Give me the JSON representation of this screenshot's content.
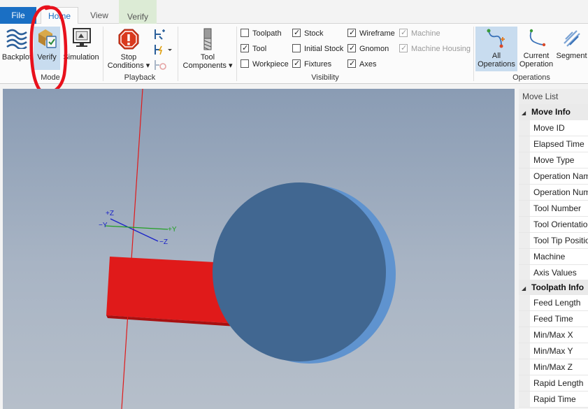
{
  "tabs": {
    "file": "File",
    "home": "Home",
    "view": "View",
    "verify": "Verify"
  },
  "ribbon": {
    "mode": {
      "label": "Mode",
      "backplot": "Backplot",
      "verify": "Verify",
      "simulation": "Simulation"
    },
    "playback": {
      "label": "Playback",
      "stop_conditions_1": "Stop",
      "stop_conditions_2": "Conditions ▾"
    },
    "tool_components": {
      "line1": "Tool",
      "line2": "Components ▾"
    },
    "visibility": {
      "label": "Visibility",
      "items": [
        {
          "label": "Toolpath",
          "checked": false,
          "enabled": true
        },
        {
          "label": "Tool",
          "checked": true,
          "enabled": true
        },
        {
          "label": "Workpiece",
          "checked": false,
          "enabled": true
        },
        {
          "label": "Stock",
          "checked": true,
          "enabled": true
        },
        {
          "label": "Initial Stock",
          "checked": false,
          "enabled": true
        },
        {
          "label": "Fixtures",
          "checked": true,
          "enabled": true
        },
        {
          "label": "Wireframe",
          "checked": true,
          "enabled": true
        },
        {
          "label": "Gnomon",
          "checked": true,
          "enabled": true
        },
        {
          "label": "Axes",
          "checked": true,
          "enabled": true
        },
        {
          "label": "Machine",
          "checked": true,
          "enabled": false
        },
        {
          "label": "Machine Housing",
          "checked": true,
          "enabled": false
        }
      ]
    },
    "operations": {
      "label": "Operations",
      "all_1": "All",
      "all_2": "Operations",
      "current_1": "Current",
      "current_2": "Operation",
      "segment": "Segment"
    }
  },
  "gnomon": {
    "plus_z": "+Z",
    "minus_y": "−Y",
    "plus_y": "+Y",
    "minus_z": "−Z"
  },
  "colors": {
    "accent": "#1a6fc4",
    "stock_face": "#416791",
    "stock_edge": "#5f93cf",
    "tool_red": "#e01a1a",
    "annotation": "#e8111c"
  },
  "move_list": {
    "title": "Move List",
    "sections": [
      {
        "title": "Move Info",
        "items": [
          "Move ID",
          "Elapsed Time",
          "Move Type",
          "Operation Name",
          "Operation Number",
          "Tool Number",
          "Tool Orientation",
          "Tool Tip Position",
          "Machine",
          "Axis Values"
        ]
      },
      {
        "title": "Toolpath Info",
        "items": [
          "Feed Length",
          "Feed Time",
          "Min/Max X",
          "Min/Max Y",
          "Min/Max Z",
          "Rapid Length",
          "Rapid Time"
        ]
      }
    ]
  }
}
